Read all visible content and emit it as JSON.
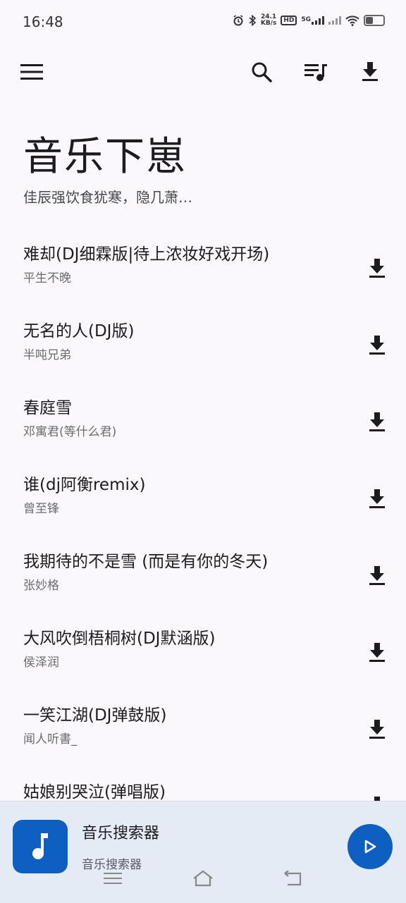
{
  "status": {
    "time": "16:48",
    "net_speed_value": "24.1",
    "net_speed_unit": "KB/s",
    "hd_label": "HD",
    "signal_label": "5G",
    "icons": [
      "alarm-icon",
      "bluetooth-icon",
      "wifi-icon",
      "battery-icon"
    ]
  },
  "toolbar": {
    "icons": [
      "menu-icon",
      "search-icon",
      "playlist-icon",
      "download-icon"
    ]
  },
  "hero": {
    "title": "音乐下崽",
    "subtitle": "佳辰强饮食犹寒，隐几萧…"
  },
  "songs": [
    {
      "title": "难却(DJ细霖版|待上浓妆好戏开场)",
      "artist": "平生不晚"
    },
    {
      "title": "无名的人(DJ版)",
      "artist": "半吨兄弟"
    },
    {
      "title": "春庭雪",
      "artist": "邓寓君(等什么君)"
    },
    {
      "title": "谁(dj阿衡remix)",
      "artist": "曾至锋"
    },
    {
      "title": "我期待的不是雪 (而是有你的冬天)",
      "artist": "张妙格"
    },
    {
      "title": "大风吹倒梧桐树(DJ默涵版)",
      "artist": "侯泽润"
    },
    {
      "title": "一笑江湖(DJ弹鼓版)",
      "artist": "闻人听書_"
    },
    {
      "title": "姑娘别哭泣(弹唱版)",
      "artist": ""
    }
  ],
  "player": {
    "title": "音乐搜索器",
    "subtitle": "音乐搜索器",
    "art_icon": "music-note-icon",
    "play_icon": "play-icon"
  },
  "colors": {
    "accent": "#0d5fc2",
    "background": "#fbf8fd",
    "player_bg": "#e4ebf4"
  }
}
